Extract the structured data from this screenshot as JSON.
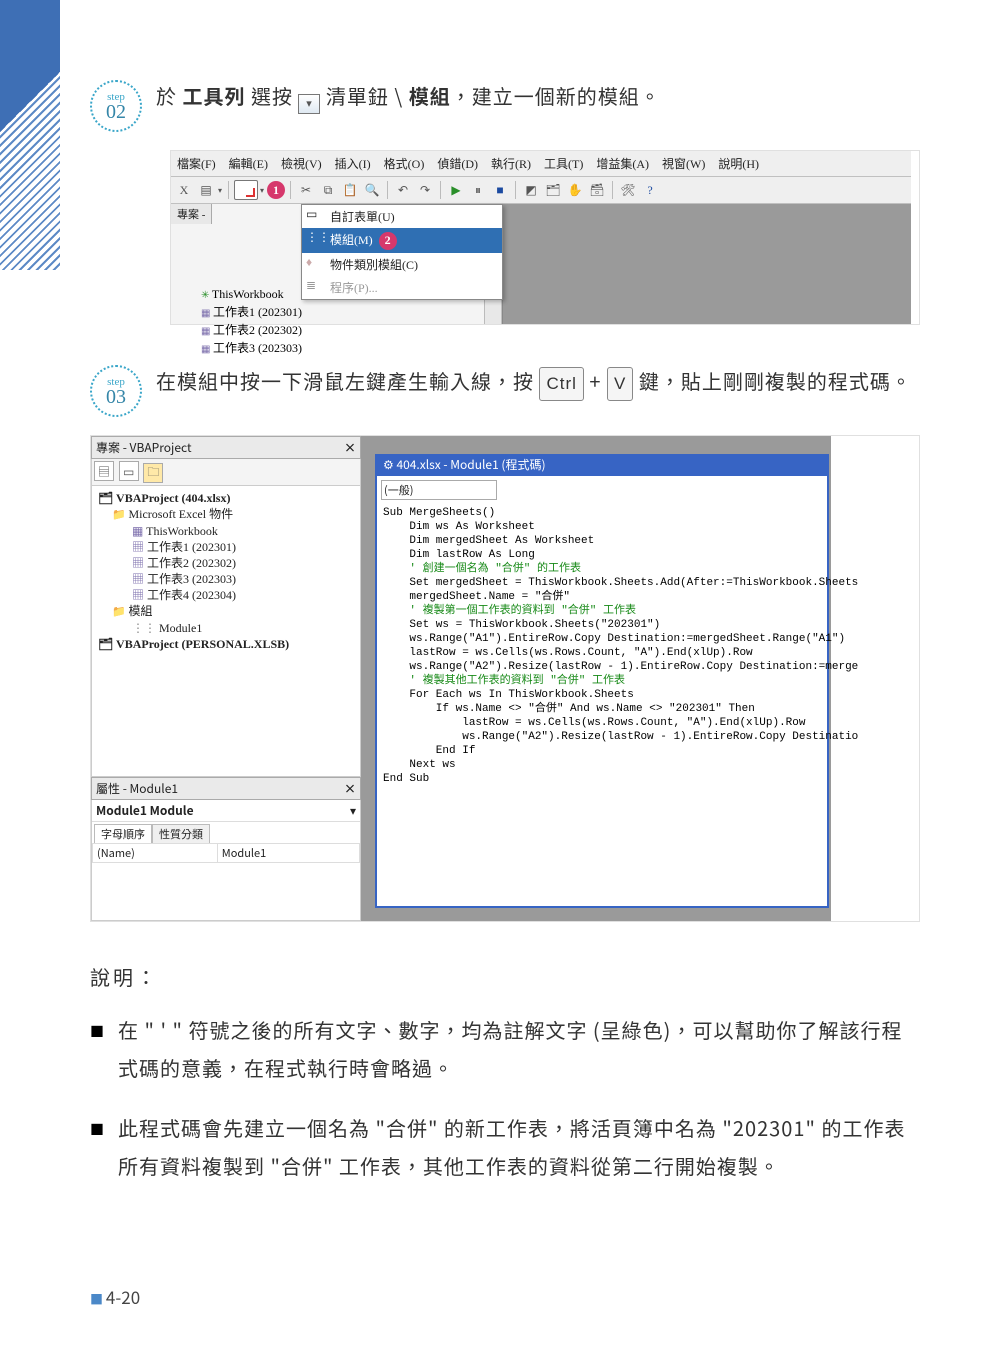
{
  "steps": {
    "s02_label": "step",
    "s02_num": "02",
    "s02_text_pre": "於 ",
    "s02_bold1": "工具列",
    "s02_text_mid1": " 選按 ",
    "s02_text_mid2": " 清單鈕 \\ ",
    "s02_bold2": "模組",
    "s02_text_end": "，建立一個新的模組。",
    "s03_label": "step",
    "s03_num": "03",
    "s03_text_pre": "在模組中按一下滑鼠左鍵產生輸入線，按 ",
    "s03_key1": "Ctrl",
    "s03_plus": " + ",
    "s03_key2": "V",
    "s03_text_end": " 鍵，貼上剛剛複製的程式碼。"
  },
  "shot1": {
    "menus": [
      "檔案(F)",
      "編輯(E)",
      "檢視(V)",
      "插入(I)",
      "格式(O)",
      "偵錯(D)",
      "執行(R)",
      "工具(T)",
      "增益集(A)",
      "視窗(W)",
      "說明(H)"
    ],
    "pane": "專案 - ",
    "ctx": {
      "u": "自訂表單(U)",
      "m": "模組(M)",
      "c": "物件類別模組(C)",
      "p": "程序(P)..."
    },
    "tree": [
      "ThisWorkbook",
      "工作表1 (202301)",
      "工作表2 (202302)",
      "工作表3 (202303)"
    ],
    "bub1": "1",
    "bub2": "2"
  },
  "shot2": {
    "pj_hdr": "專案 - VBAProject",
    "root": "VBAProject (404.xlsx)",
    "excel_folder": "Microsoft Excel 物件",
    "items": [
      "ThisWorkbook",
      "工作表1 (202301)",
      "工作表2 (202302)",
      "工作表3 (202303)",
      "工作表4 (202304)"
    ],
    "mod_folder": "模組",
    "mod": "Module1",
    "personal": "VBAProject (PERSONAL.XLSB)",
    "prop_hdr": "屬性 - Module1",
    "prop_name": "Module1 Module",
    "tab1": "字母順序",
    "tab2": "性質分類",
    "prop_k": "(Name)",
    "prop_v": "Module1",
    "code_title": "404.xlsx - Module1 (程式碼)",
    "ddl": "(一般)",
    "code_lines": [
      "Sub MergeSheets()",
      "    Dim ws As Worksheet",
      "    Dim mergedSheet As Worksheet",
      "    Dim lastRow As Long",
      "",
      "    ' 創建一個名為 \"合併\" 的工作表",
      "    Set mergedSheet = ThisWorkbook.Sheets.Add(After:=ThisWorkbook.Sheets",
      "    mergedSheet.Name = \"合併\"",
      "",
      "    ' 複製第一個工作表的資料到 \"合併\" 工作表",
      "    Set ws = ThisWorkbook.Sheets(\"202301\")",
      "    ws.Range(\"A1\").EntireRow.Copy Destination:=mergedSheet.Range(\"A1\")",
      "    lastRow = ws.Cells(ws.Rows.Count, \"A\").End(xlUp).Row",
      "    ws.Range(\"A2\").Resize(lastRow - 1).EntireRow.Copy Destination:=merge",
      "",
      "    ' 複製其他工作表的資料到 \"合併\" 工作表",
      "    For Each ws In ThisWorkbook.Sheets",
      "        If ws.Name <> \"合併\" And ws.Name <> \"202301\" Then",
      "            lastRow = ws.Cells(ws.Rows.Count, \"A\").End(xlUp).Row",
      "            ws.Range(\"A2\").Resize(lastRow - 1).EntireRow.Copy Destinatio",
      "        End If",
      "    Next ws",
      "",
      "End Sub"
    ]
  },
  "explain": {
    "heading": "說明：",
    "b1": "在 \" ' \" 符號之後的所有文字、數字，均為註解文字 (呈綠色)，可以幫助你了解該行程式碼的意義，在程式執行時會略過。",
    "b2": "此程式碼會先建立一個名為 \"合併\" 的新工作表，將活頁簿中名為 \"202301\" 的工作表所有資料複製到 \"合併\" 工作表，其他工作表的資料從第二行開始複製。"
  },
  "footer": "4-20"
}
